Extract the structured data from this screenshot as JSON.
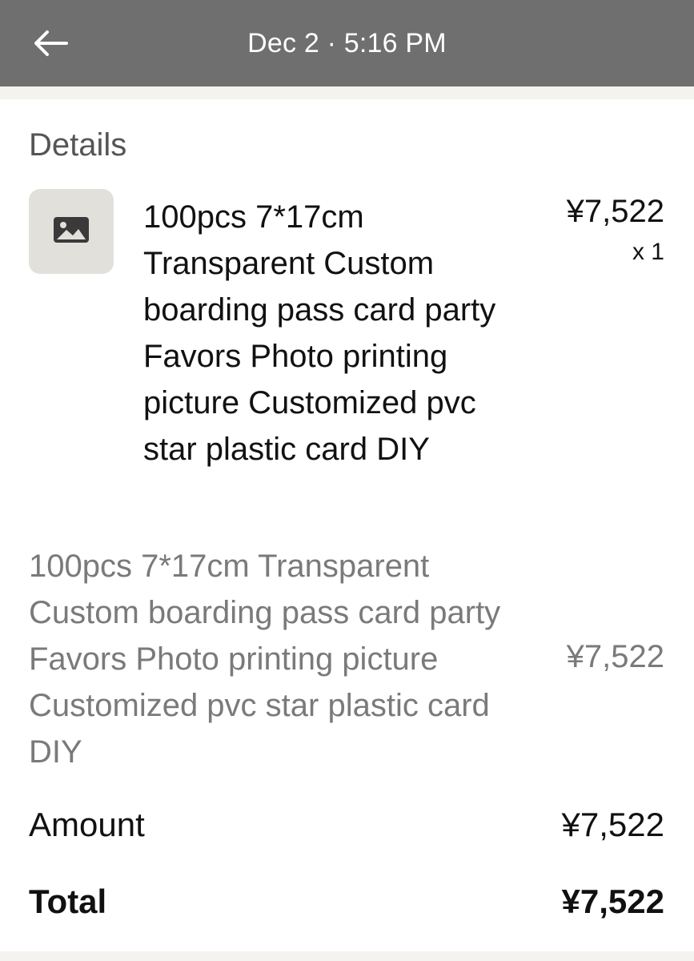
{
  "header": {
    "title": "Dec 2 · 5:16 PM",
    "back_icon": "arrow-left-icon",
    "background": "#6f6f6f"
  },
  "details": {
    "section_title": "Details",
    "item": {
      "thumbnail_icon": "image-placeholder-icon",
      "name": "100pcs 7*17cm Transparent Custom boarding pass card party Favors Photo printing picture Customized pvc star plastic card DIY",
      "price": "¥7,522",
      "quantity": "x 1"
    },
    "line_item": {
      "description": "100pcs 7*17cm Transparent Custom boarding pass card party Favors Photo printing picture Customized pvc star plastic card DIY",
      "price": "¥7,522"
    },
    "amount": {
      "label": "Amount",
      "value": "¥7,522"
    },
    "total": {
      "label": "Total",
      "value": "¥7,522"
    }
  }
}
